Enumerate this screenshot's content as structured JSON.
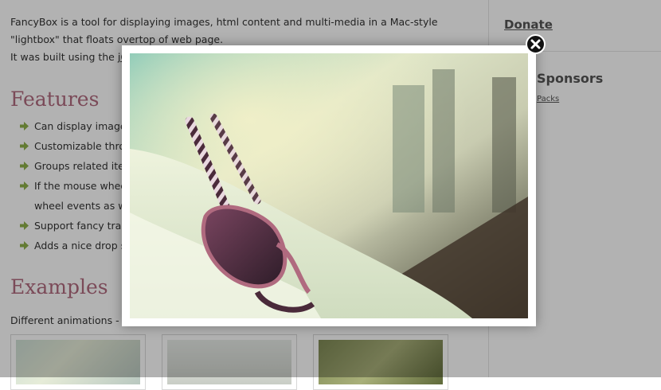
{
  "intro": {
    "line1": "FancyBox is a tool for displaying images, html content and multi-media in a Mac-style",
    "line2": "\"lightbox\" that floats overtop of web page.",
    "line3_prefix": "It was built using the ",
    "line3_link": "jQ"
  },
  "features": {
    "heading": "Features",
    "items": [
      {
        "text": "Can display images"
      },
      {
        "text": "Customizable throu"
      },
      {
        "text": "Groups related item"
      },
      {
        "text": "If the mouse whee",
        "cont": "wheel events as w"
      },
      {
        "text": "Support fancy tran"
      },
      {
        "text": "Adds a nice drop sh"
      }
    ]
  },
  "examples": {
    "heading": "Examples",
    "animations_label": "Different animations - \""
  },
  "sidebar": {
    "donate": "Donate",
    "sponsors": "Sponsors",
    "packs": "Packs"
  },
  "colors": {
    "heading": "#b06a7f",
    "arrow": "#8fb04a"
  },
  "icons": {
    "close": "close-icon",
    "arrow": "arrow-right-icon"
  }
}
